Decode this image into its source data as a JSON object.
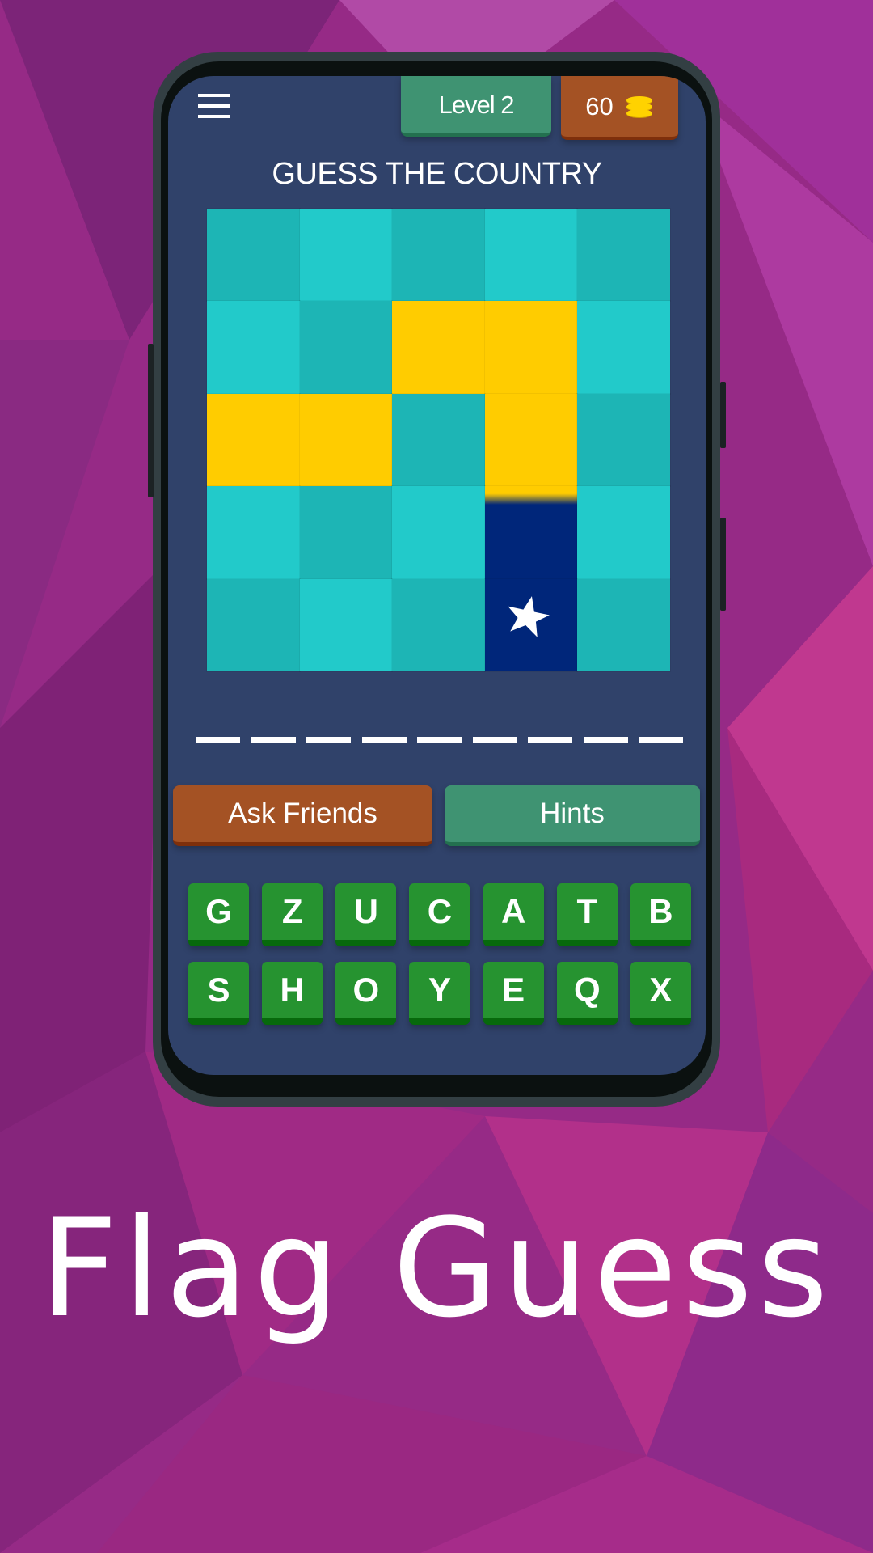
{
  "header": {
    "menu_icon": "hamburger-menu-icon",
    "level_label": "Level 2",
    "coins": "60",
    "coin_icon": "coin-stack-icon"
  },
  "title": "GUESS THE COUNTRY",
  "flag_puzzle": {
    "colors": {
      "covered_dark": "#1db5b5",
      "covered_light": "#22caca",
      "yellow": "#ffcc00",
      "navy": "#00267a"
    },
    "tiles": [
      "covered_dark",
      "covered_light",
      "covered_dark",
      "covered_light",
      "covered_dark",
      "covered_light",
      "covered_dark",
      "yellow",
      "yellow",
      "covered_light",
      "yellow",
      "yellow",
      "covered_dark",
      "yellow",
      "covered_dark",
      "covered_light",
      "covered_dark",
      "covered_light",
      "yellow_navy",
      "covered_light",
      "covered_dark",
      "covered_light",
      "covered_dark",
      "navy_star",
      "covered_dark"
    ]
  },
  "answer": {
    "letter_count": 9
  },
  "actions": {
    "ask_friends": "Ask Friends",
    "hints": "Hints"
  },
  "keyboard": {
    "row1": [
      "G",
      "Z",
      "U",
      "C",
      "A",
      "T",
      "B"
    ],
    "row2": [
      "S",
      "H",
      "O",
      "Y",
      "E",
      "Q",
      "X"
    ]
  },
  "app_name": "Flag Guess"
}
